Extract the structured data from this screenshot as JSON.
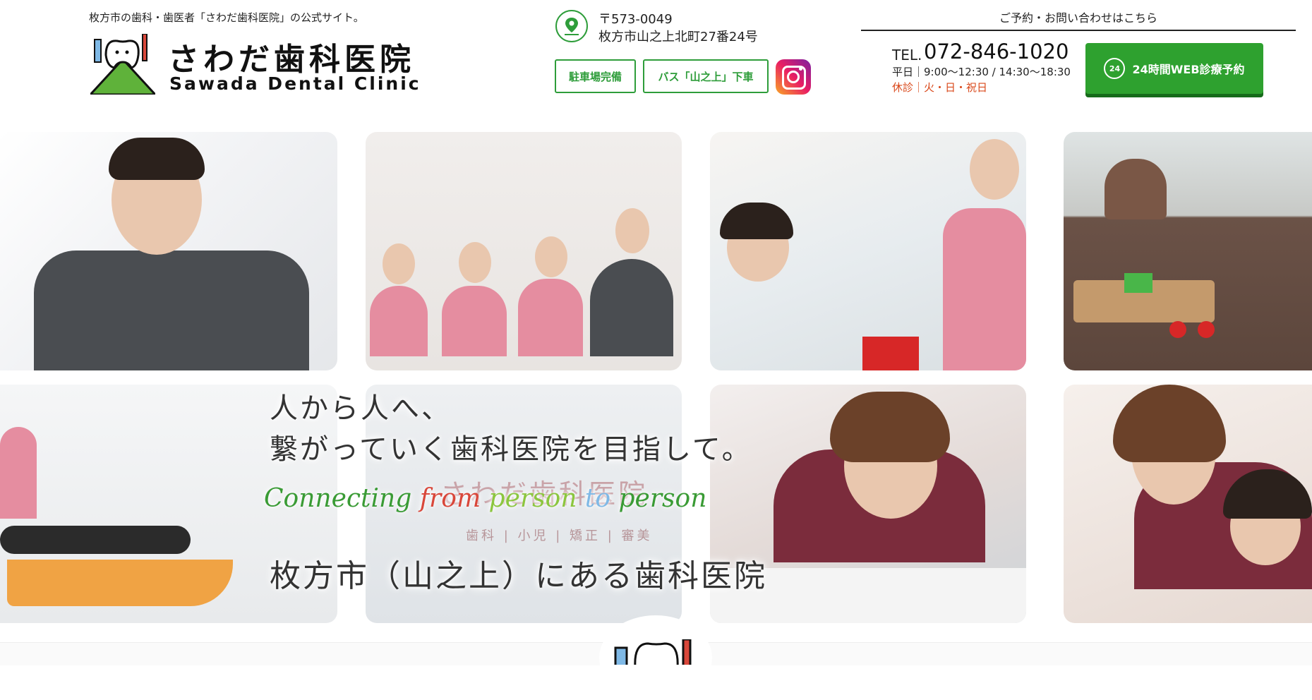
{
  "header": {
    "tagline": "枚方市の歯科・歯医者「さわだ歯科医院」の公式サイト。",
    "clinic_name_ja": "さわだ歯科医院",
    "clinic_name_en": "Sawada Dental Clinic",
    "postal_code": "〒573-0049",
    "address": "枚方市山之上北町27番24号",
    "parking_button": "駐車場完備",
    "bus_button": "バス「山之上」下車",
    "contact_title": "ご予約・お問い合わせはこちら",
    "tel_label": "TEL.",
    "tel_number": "072-846-1020",
    "hours_weekday": "平日｜9:00〜12:30 / 14:30〜18:30",
    "hours_closed": "休診｜火・日・祝日",
    "web_booking_icon": "24",
    "web_booking_label": "24時間WEB診療予約"
  },
  "hero": {
    "line1": "人から人へ、",
    "line2": "繋がっていく歯科医院を目指して。",
    "english_words": [
      "Connecting",
      "from",
      "person",
      "to",
      "person"
    ],
    "line3": "枚方市（山之上）にある歯科医院",
    "sign_text": "さわだ歯科医院",
    "sign_sub": "歯科 | 小児 | 矯正 | 審美"
  },
  "colors": {
    "brand_green": "#2ea12f",
    "outline_green": "#2e9d3a",
    "closed_red": "#d9481a",
    "en_green": "#3a9b35",
    "en_red": "#d9473a",
    "en_lime": "#8cc63f",
    "en_blue": "#7fb9e6"
  },
  "icons": [
    "map-pin-icon",
    "instagram-icon",
    "clock-24-icon",
    "tooth-logo-icon"
  ]
}
